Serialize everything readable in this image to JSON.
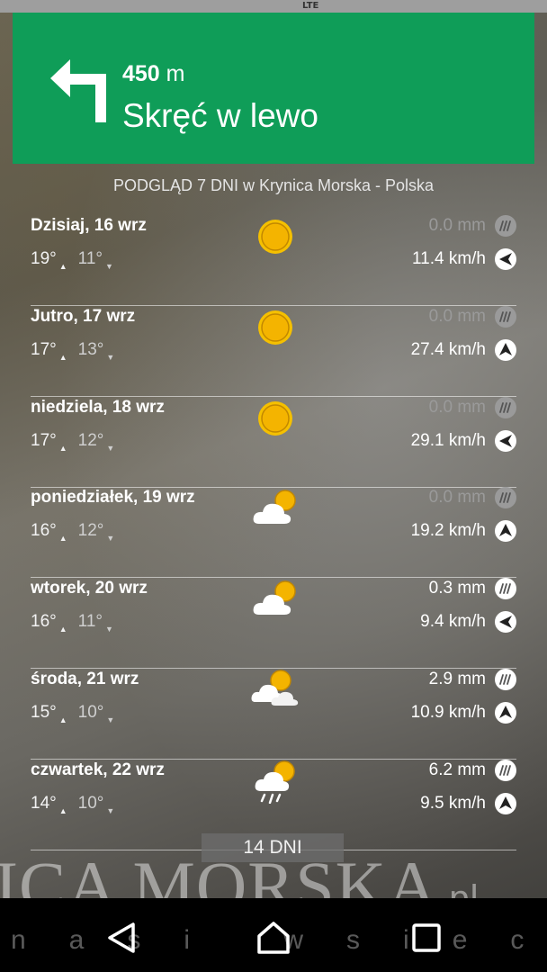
{
  "navigation": {
    "distance_value": "450",
    "distance_unit": "m",
    "instruction": "Skręć w lewo",
    "color": "#0f9d58"
  },
  "forecast": {
    "title": "PODGLĄD 7 DNI w Krynica Morska - Polska",
    "days": [
      {
        "name": "Dzisiaj, 16 wrz",
        "high": "19°",
        "low": "11°",
        "icon": "sun-icon",
        "precip": "0.0 mm",
        "wind": "11.4 km/h",
        "wind_dir": "west-arrow-icon"
      },
      {
        "name": "Jutro, 17 wrz",
        "high": "17°",
        "low": "13°",
        "icon": "sun-icon",
        "precip": "0.0 mm",
        "wind": "27.4 km/h",
        "wind_dir": "north-arrow-icon"
      },
      {
        "name": "niedziela, 18 wrz",
        "high": "17°",
        "low": "12°",
        "icon": "sun-icon",
        "precip": "0.0 mm",
        "wind": "29.1 km/h",
        "wind_dir": "west-arrow-icon"
      },
      {
        "name": "poniedziałek, 19 wrz",
        "high": "16°",
        "low": "12°",
        "icon": "partly-cloudy-icon",
        "precip": "0.0 mm",
        "wind": "19.2 km/h",
        "wind_dir": "north-arrow-icon"
      },
      {
        "name": "wtorek, 20 wrz",
        "high": "16°",
        "low": "11°",
        "icon": "partly-cloudy-icon",
        "precip": "0.3 mm",
        "wind": "9.4 km/h",
        "wind_dir": "west-arrow-icon"
      },
      {
        "name": "środa, 21 wrz",
        "high": "15°",
        "low": "10°",
        "icon": "cloudy-sun-icon",
        "precip": "2.9 mm",
        "wind": "10.9 km/h",
        "wind_dir": "north-arrow-icon"
      },
      {
        "name": "czwartek, 22 wrz",
        "high": "14°",
        "low": "10°",
        "icon": "rain-sun-icon",
        "precip": "6.2 mm",
        "wind": "9.5 km/h",
        "wind_dir": "north-arrow-icon"
      }
    ],
    "more_button": "14 DNI"
  },
  "watermark": {
    "text": "ICA MORSKA",
    "domain": ".pl"
  },
  "footer": {
    "text": "nasi wsieci"
  },
  "statusbar": {
    "network": "LTE"
  }
}
